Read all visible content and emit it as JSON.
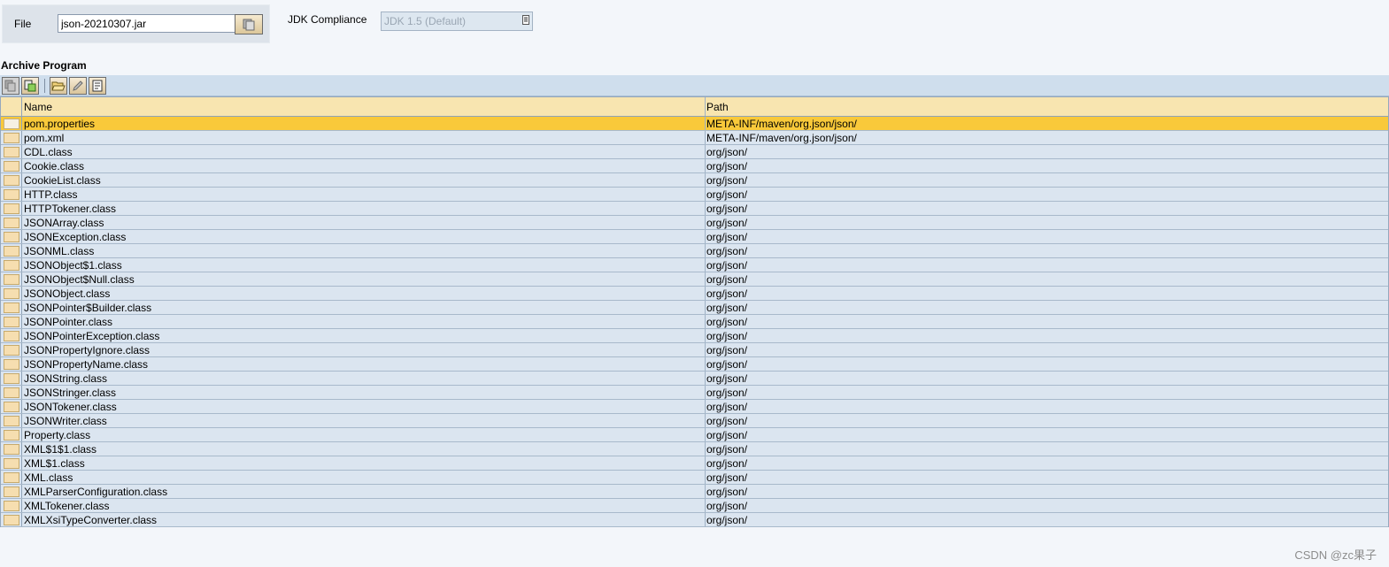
{
  "file": {
    "label": "File",
    "value": "json-20210307.jar"
  },
  "jdk": {
    "label": "JDK Compliance",
    "selected": "JDK 1.5 (Default)"
  },
  "section": {
    "title": "Archive Program"
  },
  "toolbar": {
    "icons": [
      "copy-icon",
      "paste-icon",
      "open-folder-icon",
      "edit-pencil-icon",
      "properties-icon"
    ]
  },
  "table": {
    "columns": [
      "Name",
      "Path"
    ],
    "selected_index": 0,
    "rows": [
      {
        "name": "pom.properties",
        "path": "META-INF/maven/org.json/json/"
      },
      {
        "name": "pom.xml",
        "path": "META-INF/maven/org.json/json/"
      },
      {
        "name": "CDL.class",
        "path": "org/json/"
      },
      {
        "name": "Cookie.class",
        "path": "org/json/"
      },
      {
        "name": "CookieList.class",
        "path": "org/json/"
      },
      {
        "name": "HTTP.class",
        "path": "org/json/"
      },
      {
        "name": "HTTPTokener.class",
        "path": "org/json/"
      },
      {
        "name": "JSONArray.class",
        "path": "org/json/"
      },
      {
        "name": "JSONException.class",
        "path": "org/json/"
      },
      {
        "name": "JSONML.class",
        "path": "org/json/"
      },
      {
        "name": "JSONObject$1.class",
        "path": "org/json/"
      },
      {
        "name": "JSONObject$Null.class",
        "path": "org/json/"
      },
      {
        "name": "JSONObject.class",
        "path": "org/json/"
      },
      {
        "name": "JSONPointer$Builder.class",
        "path": "org/json/"
      },
      {
        "name": "JSONPointer.class",
        "path": "org/json/"
      },
      {
        "name": "JSONPointerException.class",
        "path": "org/json/"
      },
      {
        "name": "JSONPropertyIgnore.class",
        "path": "org/json/"
      },
      {
        "name": "JSONPropertyName.class",
        "path": "org/json/"
      },
      {
        "name": "JSONString.class",
        "path": "org/json/"
      },
      {
        "name": "JSONStringer.class",
        "path": "org/json/"
      },
      {
        "name": "JSONTokener.class",
        "path": "org/json/"
      },
      {
        "name": "JSONWriter.class",
        "path": "org/json/"
      },
      {
        "name": "Property.class",
        "path": "org/json/"
      },
      {
        "name": "XML$1$1.class",
        "path": "org/json/"
      },
      {
        "name": "XML$1.class",
        "path": "org/json/"
      },
      {
        "name": "XML.class",
        "path": "org/json/"
      },
      {
        "name": "XMLParserConfiguration.class",
        "path": "org/json/"
      },
      {
        "name": "XMLTokener.class",
        "path": "org/json/"
      },
      {
        "name": "XMLXsiTypeConverter.class",
        "path": "org/json/"
      }
    ]
  },
  "watermark": "CSDN @zc果子",
  "colors": {
    "selected_row": "#f9c93a",
    "header_bg": "#f8e5b0",
    "row_bg": "#dbe5f0",
    "toolbar_bg": "#cfdeed"
  }
}
